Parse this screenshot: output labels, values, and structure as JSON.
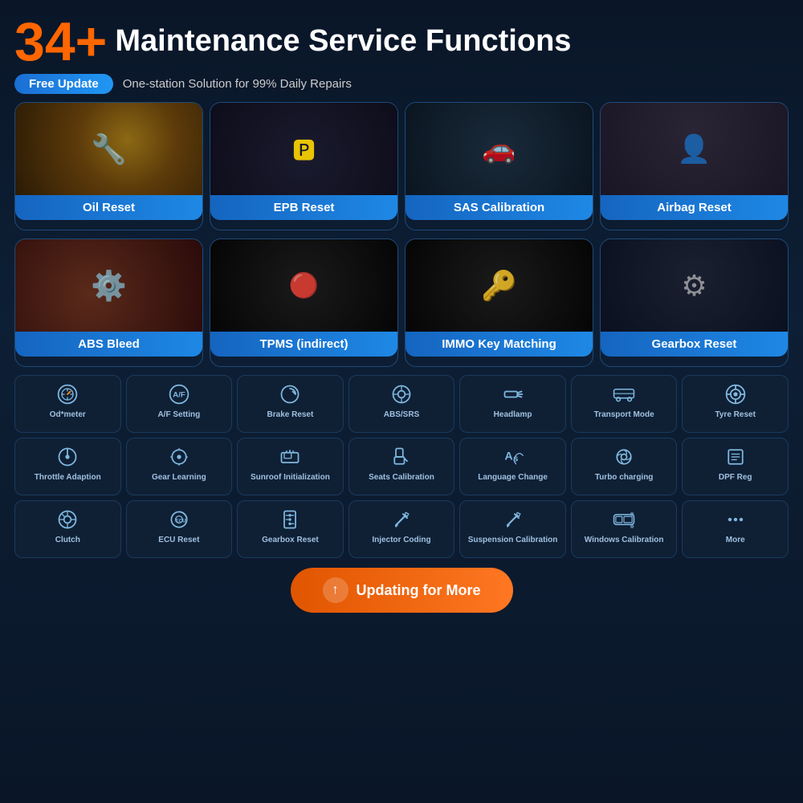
{
  "header": {
    "number": "34+",
    "title": "Maintenance Service Functions",
    "badge": "Free Update",
    "subtitle": "One-station Solution for 99% Daily Repairs"
  },
  "mainFeatures": [
    {
      "label": "Oil Reset",
      "imgClass": "photo-oil"
    },
    {
      "label": "EPB Reset",
      "imgClass": "photo-epb"
    },
    {
      "label": "SAS Calibration",
      "imgClass": "photo-sas"
    },
    {
      "label": "Airbag Reset",
      "imgClass": "photo-airbag"
    },
    {
      "label": "ABS Bleed",
      "imgClass": "photo-abs"
    },
    {
      "label": "TPMS (indirect)",
      "imgClass": "photo-tpms"
    },
    {
      "label": "IMMO Key Matching",
      "imgClass": "photo-immo"
    },
    {
      "label": "Gearbox Reset",
      "imgClass": "photo-gearbox"
    }
  ],
  "iconRows": [
    [
      {
        "label": "Od*meter",
        "symbol": "🕛"
      },
      {
        "label": "A/F Setting",
        "symbol": "A/F"
      },
      {
        "label": "Brake Reset",
        "symbol": "⟳"
      },
      {
        "label": "ABS/SRS",
        "symbol": "⊙"
      },
      {
        "label": "Headlamp",
        "symbol": "💡"
      },
      {
        "label": "Transport Mode",
        "symbol": "🚗"
      },
      {
        "label": "Tyre Reset",
        "symbol": "⚙"
      }
    ],
    [
      {
        "label": "Throttle Adaption",
        "symbol": "○"
      },
      {
        "label": "Gear Learning",
        "symbol": "⚙"
      },
      {
        "label": "Sunroof Initialization",
        "symbol": "⊡"
      },
      {
        "label": "Seats Calibration",
        "symbol": "💺"
      },
      {
        "label": "Language Change",
        "symbol": "A↔"
      },
      {
        "label": "Turbo charging",
        "symbol": "⚙"
      },
      {
        "label": "DPF Reg",
        "symbol": "≡"
      }
    ],
    [
      {
        "label": "Clutch",
        "symbol": "⊙"
      },
      {
        "label": "ECU Reset",
        "symbol": "⚙"
      },
      {
        "label": "Gearbox Reset",
        "symbol": "⊞"
      },
      {
        "label": "Injector Coding",
        "symbol": "↗"
      },
      {
        "label": "Suspension Calibration",
        "symbol": "↗"
      },
      {
        "label": "Windows Calibration",
        "symbol": "🚗"
      },
      {
        "label": "More",
        "symbol": "···"
      }
    ]
  ],
  "updateButton": {
    "label": "Updating for More"
  }
}
